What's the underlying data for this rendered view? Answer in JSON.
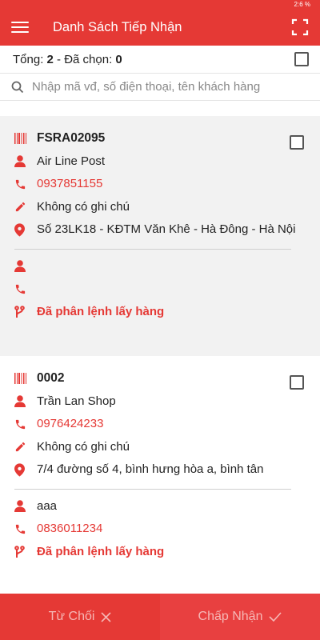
{
  "status": {
    "text": "2:6 %"
  },
  "header": {
    "title": "Danh Sách Tiếp Nhận"
  },
  "summary": {
    "total_label": "Tổng: ",
    "total": "2",
    "sep": " - Đã chọn: ",
    "selected": "0"
  },
  "search": {
    "placeholder": "Nhập mã vđ, số điện thoại, tên khách hàng"
  },
  "orders": [
    {
      "code": "FSRA02095",
      "customer": "Air Line Post",
      "phone": "0937851155",
      "note": "Không có ghi chú",
      "address": "Số 23LK18 - KĐTM Văn Khê - Hà Đông - Hà Nội",
      "receiver": "",
      "receiver_phone": "",
      "status": "Đã phân lệnh lấy hàng"
    },
    {
      "code": "0002",
      "customer": "Trần Lan Shop",
      "phone": "0976424233",
      "note": "Không có ghi chú",
      "address": "7/4 đường số 4, bình hưng hòa a, bình tân",
      "receiver": "aaa",
      "receiver_phone": "0836011234",
      "status": "Đã phân lệnh lấy hàng"
    }
  ],
  "footer": {
    "reject_label": "Từ Chối",
    "accept_label": "Chấp Nhận"
  },
  "colors": {
    "primary": "#e53935",
    "muted_text": "#f6b7b5"
  },
  "icons": [
    "menu-icon",
    "fullscreen-icon",
    "search-icon",
    "barcode-icon",
    "user-icon",
    "phone-icon",
    "pencil-icon",
    "location-icon",
    "route-icon",
    "close-icon",
    "check-icon"
  ]
}
